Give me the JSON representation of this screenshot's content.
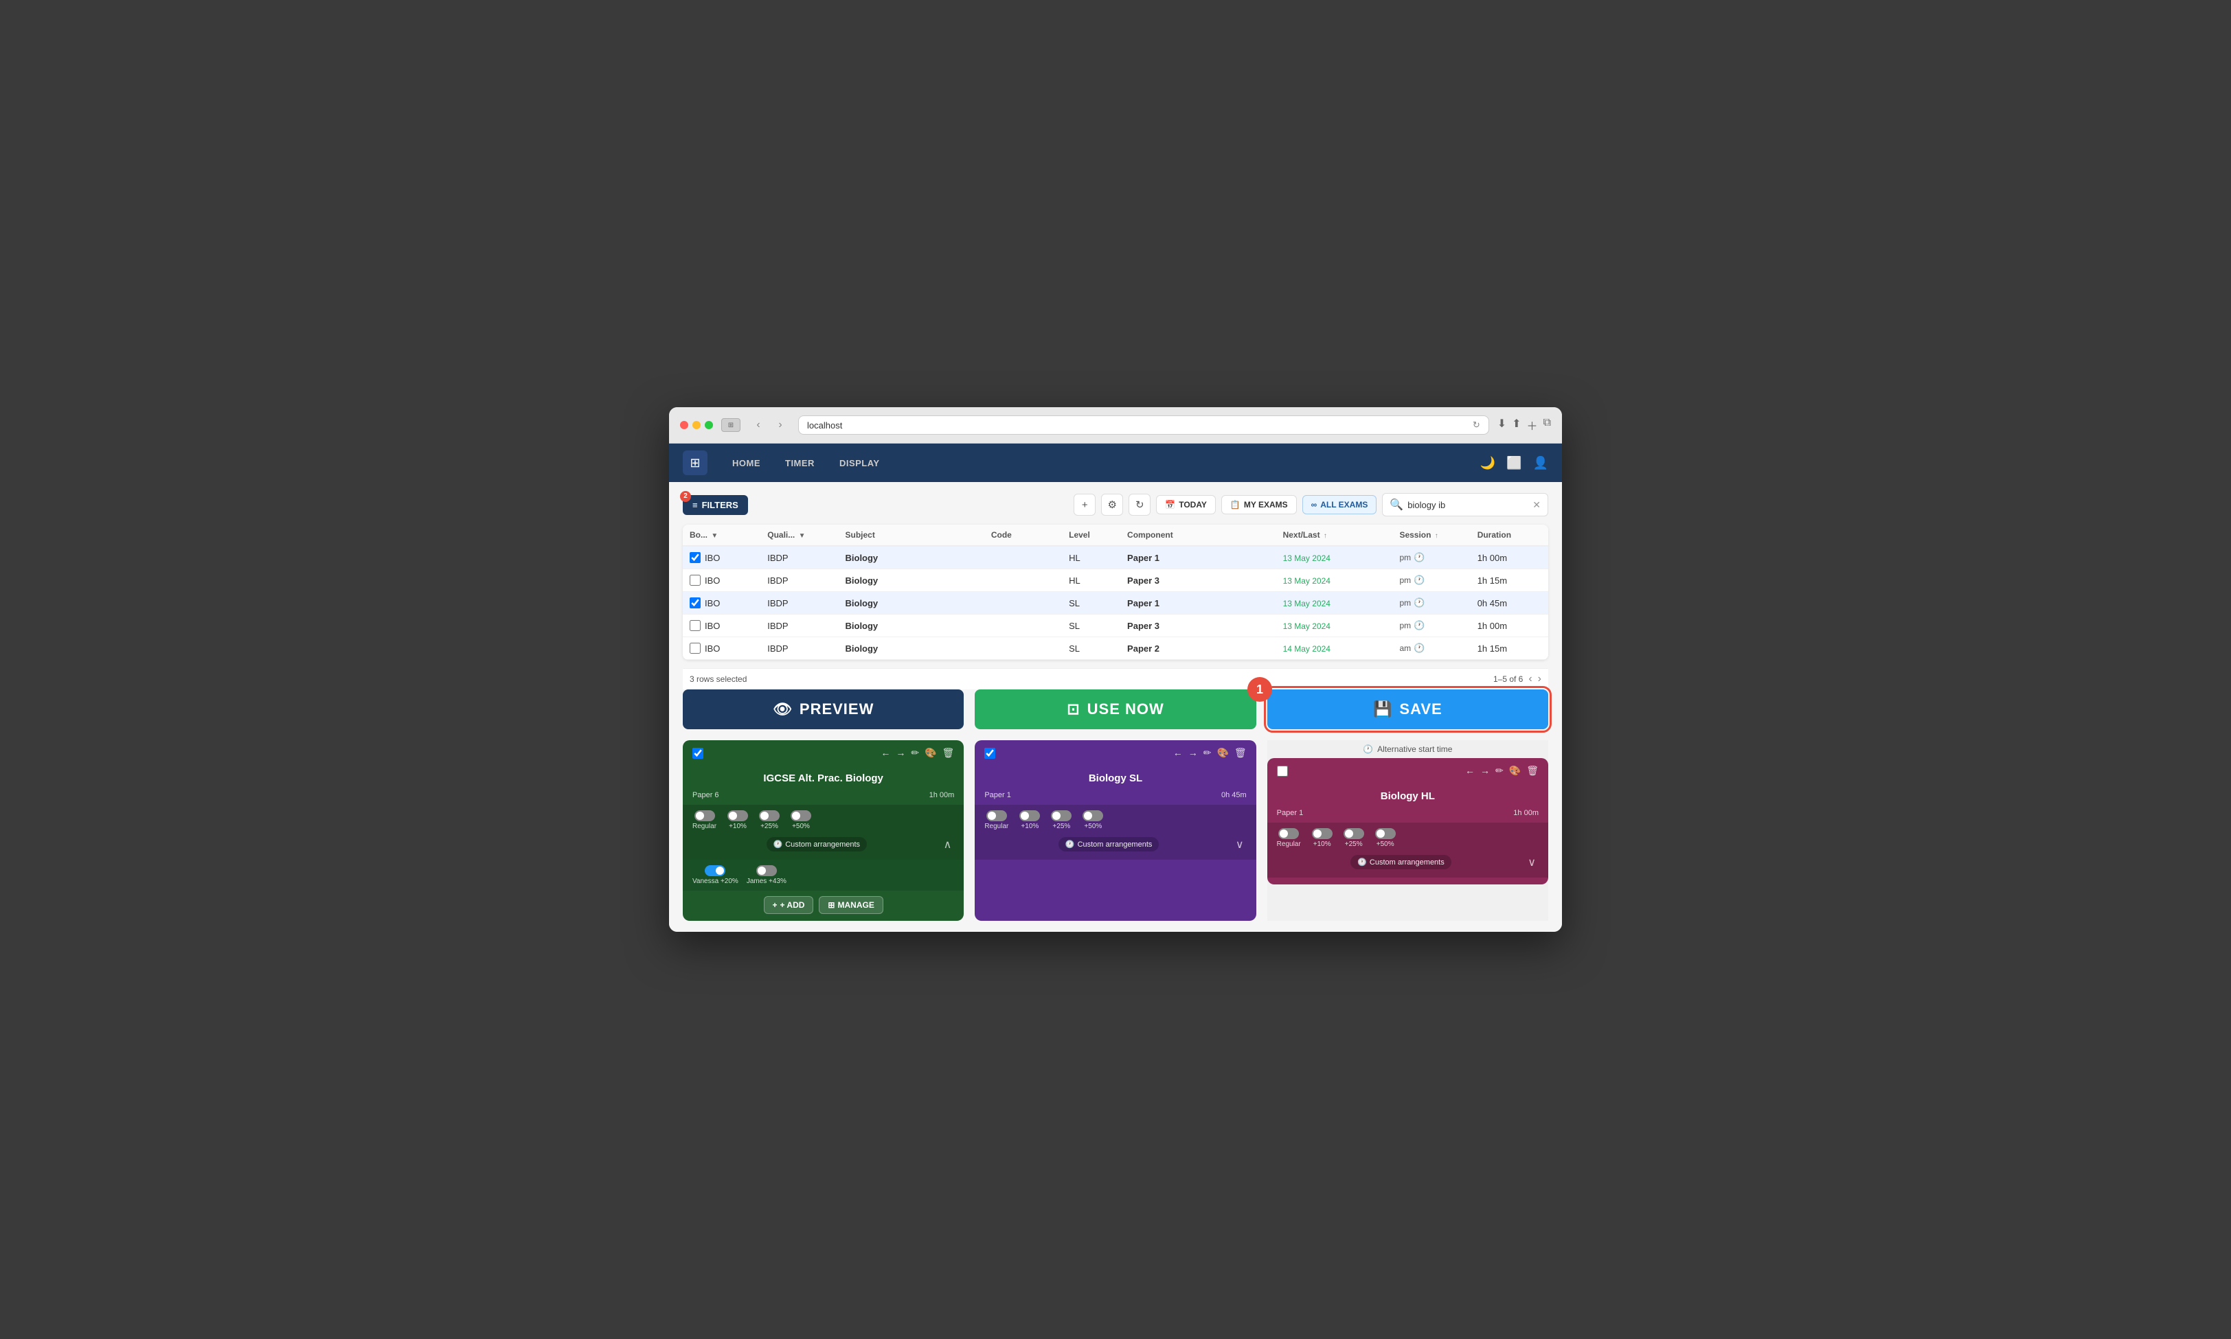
{
  "browser": {
    "url": "localhost",
    "refresh_icon": "↻"
  },
  "app": {
    "logo_icon": "⊞",
    "nav": {
      "items": [
        {
          "label": "HOME"
        },
        {
          "label": "TIMER"
        },
        {
          "label": "DISPLAY"
        }
      ]
    },
    "header_icons": [
      "🌙",
      "⬜",
      "👤"
    ]
  },
  "toolbar": {
    "filter_btn_label": "FILTERS",
    "filter_count": "2",
    "add_icon": "+",
    "settings_icon": "⚙",
    "refresh_icon": "↻",
    "today_btn": "TODAY",
    "my_exams_btn": "MY EXAMS",
    "all_exams_btn": "ALL EXAMS",
    "search_placeholder": "biology ib",
    "search_value": "biology ib",
    "clear_icon": "✕"
  },
  "table": {
    "columns": [
      "",
      "Bo...",
      "",
      "Quali...",
      "",
      "Subject",
      "Code",
      "Level",
      "Component",
      "Next/Last",
      "",
      "Session",
      "",
      "Duration"
    ],
    "rows": [
      {
        "checked": true,
        "board": "IBO",
        "quali": "IBDP",
        "subject": "Biology",
        "code": "",
        "level": "HL",
        "component": "Paper 1",
        "next_date": "13 May 2024",
        "date_color": "green",
        "session": "pm",
        "duration": "1h 00m",
        "selected": true
      },
      {
        "checked": false,
        "board": "IBO",
        "quali": "IBDP",
        "subject": "Biology",
        "code": "",
        "level": "HL",
        "component": "Paper 3",
        "next_date": "13 May 2024",
        "date_color": "green",
        "session": "pm",
        "duration": "1h 15m",
        "selected": false
      },
      {
        "checked": true,
        "board": "IBO",
        "quali": "IBDP",
        "subject": "Biology",
        "code": "",
        "level": "SL",
        "component": "Paper 1",
        "next_date": "13 May 2024",
        "date_color": "green",
        "session": "pm",
        "duration": "0h 45m",
        "selected": true
      },
      {
        "checked": false,
        "board": "IBO",
        "quali": "IBDP",
        "subject": "Biology",
        "code": "",
        "level": "SL",
        "component": "Paper 3",
        "next_date": "13 May 2024",
        "date_color": "green",
        "session": "pm",
        "duration": "1h 00m",
        "selected": false
      },
      {
        "checked": false,
        "board": "IBO",
        "quali": "IBDP",
        "subject": "Biology",
        "code": "",
        "level": "SL",
        "component": "Paper 2",
        "next_date": "14 May 2024",
        "date_color": "green",
        "session": "am",
        "duration": "1h 15m",
        "selected": false
      }
    ],
    "footer": {
      "rows_selected": "3 rows selected",
      "pagination": "1–5 of 6"
    }
  },
  "action_buttons": {
    "preview": {
      "label": "PREVIEW",
      "icon": "👁"
    },
    "use_now": {
      "label": "USE NOW",
      "icon": "⊡"
    },
    "save": {
      "label": "SAVE",
      "icon": "💾"
    }
  },
  "cards": {
    "alt_start_time": "Alternative start time",
    "preview_card": {
      "title": "IGCSE Alt. Prac. Biology",
      "subtitle_left": "Paper 6",
      "subtitle_right": "1h 00m",
      "checked": true,
      "color": "#1e5a2a",
      "toggles": [
        {
          "label": "Regular",
          "on": false
        },
        {
          "label": "+10%",
          "on": false
        },
        {
          "label": "+25%",
          "on": false
        },
        {
          "label": "+50%",
          "on": false
        }
      ],
      "users": [
        {
          "name": "Vanessa",
          "percent": "+20%",
          "on": true
        },
        {
          "name": "James",
          "percent": "+43%",
          "on": false
        }
      ],
      "custom_arrangements": "Custom arrangements",
      "add_label": "+ ADD",
      "manage_label": "MANAGE"
    },
    "use_card": {
      "title": "Biology SL",
      "subtitle_left": "Paper 1",
      "subtitle_right": "0h 45m",
      "checked": true,
      "color": "#5b2d8e",
      "toggles": [
        {
          "label": "Regular",
          "on": false
        },
        {
          "label": "+10%",
          "on": false
        },
        {
          "label": "+25%",
          "on": false
        },
        {
          "label": "+50%",
          "on": false
        }
      ],
      "custom_arrangements": "Custom arrangements"
    },
    "save_card": {
      "title": "Biology HL",
      "subtitle_left": "Paper 1",
      "subtitle_right": "1h 00m",
      "checked": false,
      "color": "#8e2a5a",
      "toggles": [
        {
          "label": "Regular",
          "on": false
        },
        {
          "label": "+10%",
          "on": false
        },
        {
          "label": "+25%",
          "on": false
        },
        {
          "label": "+50%",
          "on": false
        }
      ],
      "custom_arrangements": "Custom arrangements"
    }
  },
  "numbered_badge": "1"
}
